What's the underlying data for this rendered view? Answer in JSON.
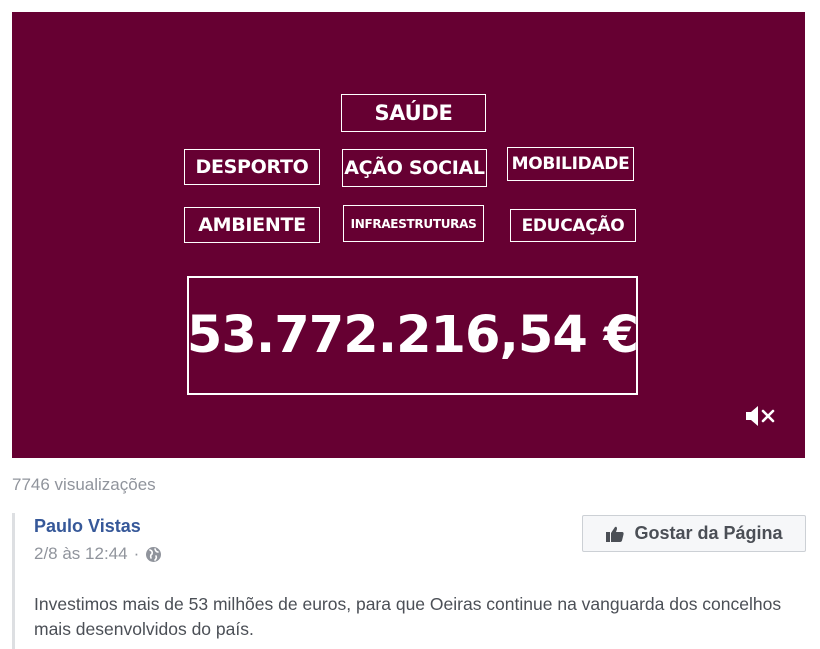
{
  "video": {
    "categories": {
      "saude": "SAÚDE",
      "desporto": "DESPORTO",
      "acao_social": "AÇÃO SOCIAL",
      "mobilidade": "MOBILIDADE",
      "ambiente": "AMBIENTE",
      "infraestruturas": "INFRAESTRUTURAS",
      "educacao": "EDUCAÇÃO"
    },
    "amount": "53.772.216,54 €",
    "background_color": "#660032",
    "mute_icon": "speaker-muted-icon"
  },
  "views": "7746 visualizações",
  "post": {
    "author": "Paulo Vistas",
    "date": "2/8 às 12:44",
    "separator": "·",
    "audience_icon": "globe-icon",
    "like_page_button": "Gostar da Página",
    "like_icon": "thumbs-up-icon",
    "text": "Investimos mais de 53 milhões de euros, para que Oeiras continue na vanguarda dos concelhos mais desenvolvidos do país."
  },
  "colors": {
    "link": "#365899",
    "muted": "#90949c",
    "body_text": "#4b4f56"
  }
}
